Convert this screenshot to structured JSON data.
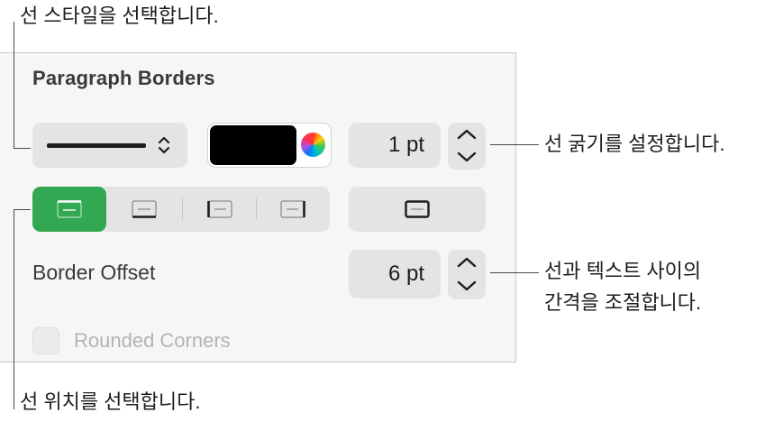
{
  "panel": {
    "title": "Paragraph Borders",
    "line_style": {
      "icon": "solid-line-icon"
    },
    "color_well": {
      "color": "#000000"
    },
    "width": {
      "value": "1 pt"
    },
    "positions": [
      {
        "name": "top-border",
        "active": true
      },
      {
        "name": "bottom-border",
        "active": false
      },
      {
        "name": "left-border",
        "active": false
      },
      {
        "name": "right-border",
        "active": false
      }
    ],
    "frame_button": {
      "icon": "frame-icon"
    },
    "border_offset": {
      "label": "Border Offset",
      "value": "6 pt"
    },
    "rounded_corners": {
      "label": "Rounded Corners",
      "checked": false,
      "enabled": false
    }
  },
  "callouts": {
    "style": "선 스타일을 선택합니다.",
    "width": "선 굵기를 설정합니다.",
    "offset_line1": "선과 텍스트 사이의",
    "offset_line2": "간격을 조절합니다.",
    "position": "선 위치를 선택합니다."
  },
  "colors": {
    "accent": "#32a852",
    "panel_bg": "#f6f6f6",
    "control_bg": "#e4e4e4"
  }
}
